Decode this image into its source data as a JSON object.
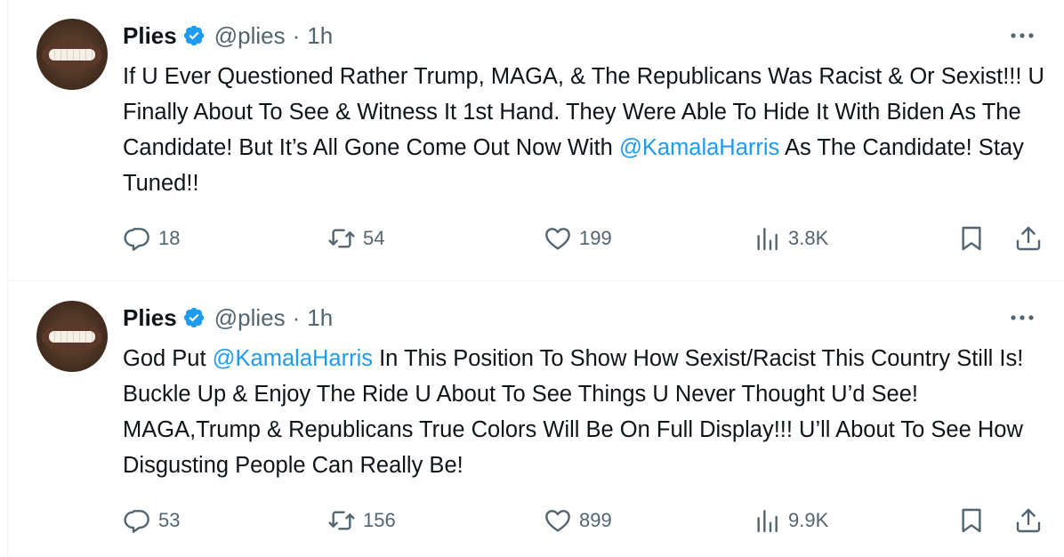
{
  "tweets": [
    {
      "author": {
        "name": "Plies",
        "handle": "@plies",
        "verified": true
      },
      "separator": "·",
      "time": "1h",
      "text": [
        {
          "t": "If U Ever Questioned Rather Trump, MAGA, & The Republicans Was Racist & Or Sexist!!! U Finally About To See & Witness It 1st Hand. They Were Able To Hide It With Biden As The Candidate! But It’s All Gone Come Out Now With "
        },
        {
          "t": "@KamalaHarris",
          "mention": true
        },
        {
          "t": " As The Candidate! Stay Tuned!!"
        }
      ],
      "stats": {
        "replies": "18",
        "reposts": "54",
        "likes": "199",
        "views": "3.8K"
      }
    },
    {
      "author": {
        "name": "Plies",
        "handle": "@plies",
        "verified": true
      },
      "separator": "·",
      "time": "1h",
      "text": [
        {
          "t": "God Put "
        },
        {
          "t": "@KamalaHarris",
          "mention": true
        },
        {
          "t": " In This Position To Show How Sexist/Racist This Country Still Is! Buckle Up & Enjoy The Ride U About To See Things U Never Thought U’d See! MAGA,Trump & Republicans True Colors Will Be On Full Display!!! U’ll About To See How Disgusting People Can Really Be!"
        }
      ],
      "stats": {
        "replies": "53",
        "reposts": "156",
        "likes": "899",
        "views": "9.9K"
      }
    }
  ],
  "icons": {
    "verified": "verified-badge-icon",
    "more": "more-options-icon",
    "reply": "reply-icon",
    "repost": "repost-icon",
    "like": "heart-icon",
    "views": "views-chart-icon",
    "bookmark": "bookmark-icon",
    "share": "share-icon"
  },
  "colors": {
    "mention": "#1d9bf0",
    "secondary_text": "#536471",
    "verified_badge": "#1d9bf0",
    "text": "#0f1419"
  }
}
